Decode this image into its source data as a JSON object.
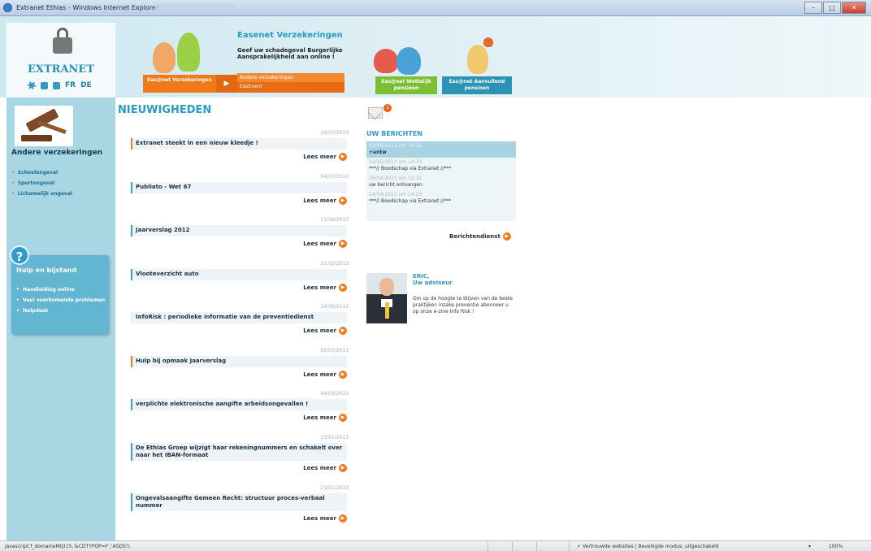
{
  "window": {
    "title": "Extranet Ethias - Windows Internet Explorer",
    "buttons": {
      "minimize": "–",
      "maximize": "□",
      "close": "✕"
    }
  },
  "header": {
    "brand": "EXTRANET",
    "languages": [
      "FR",
      "DE"
    ],
    "promo": {
      "title": "Easenet Verzekeringen",
      "text": "Geef uw schadegeval Burgerlijke Aansprakelijkheid aan online !"
    },
    "tabs": {
      "main": "Eas@net Verzekeringen",
      "arrow": "▶",
      "sub_items": [
        "Andere verzekeringen",
        "EasEvent"
      ],
      "green": "Eas@net Wettelijk pensioen",
      "teal": "Eas@net Aanvullend pensioen"
    }
  },
  "sidebar": {
    "title": "Andere verzekeringen",
    "links": [
      "Schoolongeval",
      "Sportongeval",
      "Lichamelijk ongeval"
    ],
    "help": {
      "icon": "?",
      "title": "Hulp en bijstand",
      "links": [
        "Handleiding online",
        "Veel voorkomende problemen",
        "Helpdesk"
      ]
    }
  },
  "news": {
    "title": "NIEUWIGHEDEN",
    "read_more": "Lees meer",
    "items": [
      {
        "date": "16/07/2013",
        "title": "Extranet steekt in een nieuw kleedje !",
        "accent": "orange"
      },
      {
        "date": "04/07/2013",
        "title": "Publiato - Wet 67",
        "accent": "blue"
      },
      {
        "date": "11/06/2013",
        "title": "Jaarverslag 2012",
        "accent": "blue"
      },
      {
        "date": "31/05/2013",
        "title": "Vlooteverzicht auto",
        "accent": "blue"
      },
      {
        "date": "24/05/2013",
        "title": "InfoRisk : periodieke informatie van de preventiedienst",
        "accent": "none"
      },
      {
        "date": "05/03/2013",
        "title": "Hulp bij opmaak Jaarverslag",
        "accent": "orange"
      },
      {
        "date": "04/03/2013",
        "title": "verplichte elektronische aangifte arbeidsongevallen !",
        "accent": "blue"
      },
      {
        "date": "23/01/2013",
        "title": "De Ethias Groep wijzigt haar rekeningnummers en schakelt over naar het IBAN-formaat",
        "accent": "blue"
      },
      {
        "date": "21/01/2013",
        "title": "Ongevalsaangifte Gemeen Recht: structuur proces-verbaal nummer",
        "accent": "blue"
      }
    ]
  },
  "messages": {
    "badge": "1",
    "title": "UW BERICHTEN",
    "items": [
      {
        "date": "03/06/2013 om 10:23",
        "text": "+antw",
        "highlight": true
      },
      {
        "date": "22/05/2013 om 14:33",
        "text": "***// Boodschap via Extranet //***",
        "highlight": false
      },
      {
        "date": "26/04/2013 om 12:32",
        "text": "uw bericht ontvangen",
        "highlight": false
      },
      {
        "date": "24/04/2013 om 14:23",
        "text": "***// Boodschap via Extranet //***",
        "highlight": false
      }
    ],
    "service_link": "Berichtendienst"
  },
  "advisor": {
    "name": "ERIC,",
    "role": "Uw adviseur",
    "text": "Om op de hoogte te blijven van de beste praktijken inzake preventie abonneer u op onze e-zine Info Risk !"
  },
  "statusbar": {
    "url": "javascript:f_domaineMQ(15,'&CDTYPOP=F','ASDS');",
    "zone": "Vertrouwde websites | Beveiligde modus: uitgeschakeld",
    "zoom": "100%"
  }
}
